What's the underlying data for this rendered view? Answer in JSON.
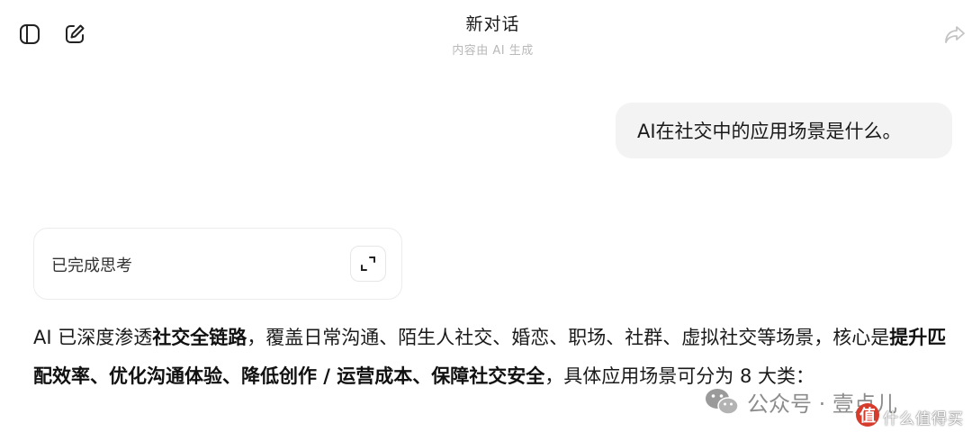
{
  "header": {
    "title": "新对话",
    "subtitle": "内容由 AI 生成",
    "sidebar_icon": "sidebar-toggle-icon",
    "new_chat_icon": "edit-icon",
    "share_icon": "share-icon"
  },
  "user_message": {
    "text": "AI在社交中的应用场景是什么。"
  },
  "thinking": {
    "label": "已完成思考",
    "expand_icon": "expand-icon"
  },
  "answer": {
    "seg1": "AI 已深度渗透",
    "seg2": "社交全链路",
    "seg3": "，覆盖日常沟通、陌生人社交、婚恋、职场、社群、虚拟社交等场景，核心是",
    "seg4": "提升匹配效率、优化沟通体验、降低创作 / 运营成本、保障社交安全",
    "seg5": "，具体应用场景可分为 8 大类："
  },
  "watermark": {
    "text": "公众号 · 壹点儿",
    "icon": "wechat-icon",
    "logo_char": "值",
    "site_text": "什么值得买"
  }
}
